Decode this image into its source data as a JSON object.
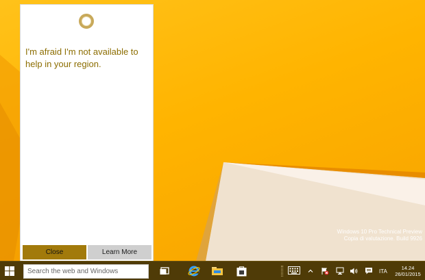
{
  "cortana": {
    "message": "I'm afraid I'm not available to help in your region.",
    "close_label": "Close",
    "learn_more_label": "Learn More",
    "icon": "cortana-ring-icon"
  },
  "taskbar": {
    "search_placeholder": "Search the web and Windows",
    "apps": [
      "task-view-icon",
      "internet-explorer-icon",
      "file-explorer-icon",
      "store-icon"
    ],
    "tray": {
      "keyboard_icon": "touch-keyboard-icon",
      "language": "ITA",
      "time": "14.24",
      "date": "26/01/2015"
    }
  },
  "watermark": {
    "line1": "Windows 10 Pro Technical Preview",
    "line2": "Copia di valutazione. Build 9926"
  },
  "colors": {
    "accent": "#a27a0b",
    "taskbar": "#4f3b07",
    "desktop": "#ffb400",
    "message_text": "#8c6d00"
  }
}
